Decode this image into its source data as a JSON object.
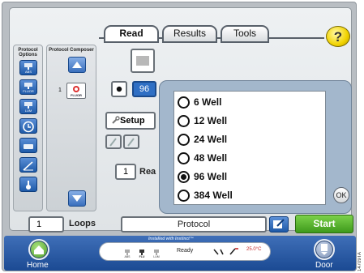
{
  "tabs": [
    {
      "label": "Read",
      "active": true
    },
    {
      "label": "Results",
      "active": false
    },
    {
      "label": "Tools",
      "active": false
    }
  ],
  "help": {
    "label": "?"
  },
  "left_panel": {
    "title": "Protocol Options",
    "items": [
      {
        "label": "ABS",
        "icon": "absorbance-icon"
      },
      {
        "label": "FLUOR",
        "icon": "fluorescence-icon"
      },
      {
        "label": "LUM",
        "icon": "luminescence-icon"
      },
      {
        "label": "",
        "icon": "timer-icon"
      },
      {
        "label": "",
        "icon": "shake-icon"
      },
      {
        "label": "",
        "icon": "kinetic-icon"
      },
      {
        "label": "",
        "icon": "temperature-icon"
      }
    ]
  },
  "composer_panel": {
    "title": "Protocol Composer",
    "step_number": "1",
    "step_label": "FLUOR"
  },
  "read_area": {
    "well_count_value": "96",
    "setup_label": "Setup",
    "reads_value": "1",
    "reads_label": "Rea"
  },
  "well_popup": {
    "options": [
      {
        "label": "6 Well",
        "selected": false
      },
      {
        "label": "12 Well",
        "selected": false
      },
      {
        "label": "24 Well",
        "selected": false
      },
      {
        "label": "48 Well",
        "selected": false
      },
      {
        "label": "96 Well",
        "selected": true
      },
      {
        "label": "384 Well",
        "selected": false
      }
    ],
    "ok_label": "OK"
  },
  "bottom": {
    "loops_value": "1",
    "loops_label": "Loops",
    "protocol_label": "Protocol",
    "start_label": "Start"
  },
  "status_bar": {
    "home_label": "Home",
    "door_label": "Door",
    "installed_text": "Installed with Instinct™",
    "modes": [
      "ABS",
      "FLU",
      "LUM"
    ],
    "status_text": "Ready",
    "temperature": "25.0°C"
  },
  "image_code": "14709TA",
  "colors": {
    "tab_border": "#58606a",
    "start_green": "#3e9a1c",
    "icon_blue": "#1e5aa8",
    "popup_bg": "#a3b7cc",
    "status_blue": "#1b4a93",
    "help_yellow": "#f2d300",
    "temp_red": "#c62828"
  }
}
